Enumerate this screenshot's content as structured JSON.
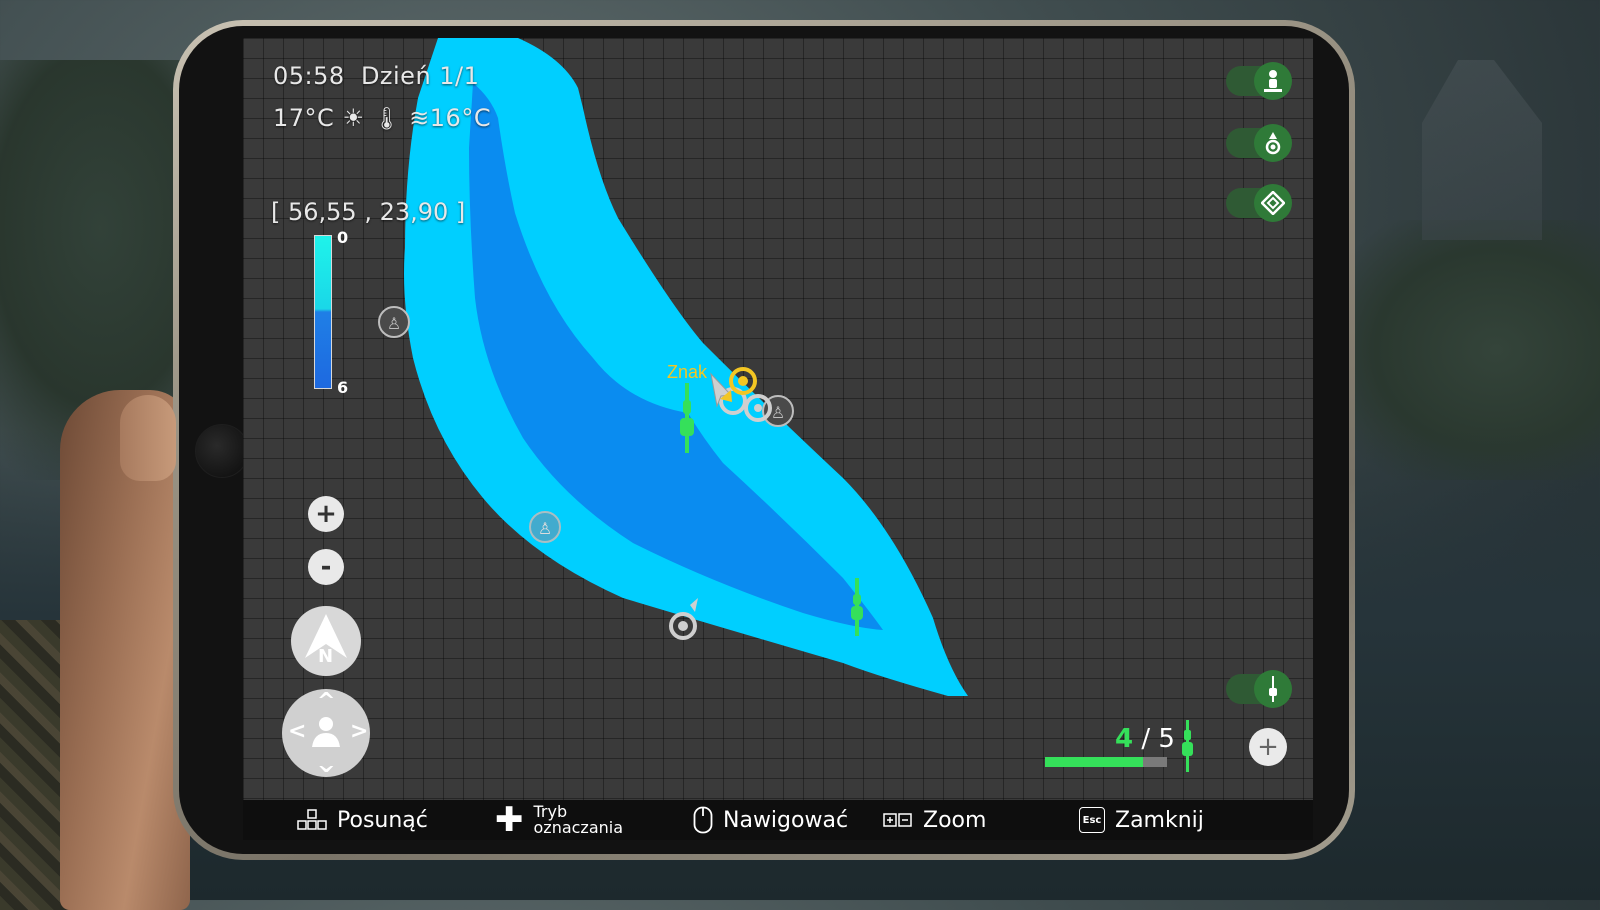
{
  "hud": {
    "time": "05:58",
    "day": "Dzień 1/1",
    "air_temp": "17°C",
    "water_temp": "16°C",
    "coordinates": "[ 56,55 , 23,90 ]"
  },
  "depth_scale": {
    "min": "0",
    "max": "6",
    "shallow_color": "#1ff3ea",
    "deep_color": "#1e69e0"
  },
  "map": {
    "marker_label": "Znak",
    "lake_shallow_color": "#00cfff",
    "lake_deep_color": "#0a8cf0",
    "grid_background": "#3a3a3a"
  },
  "controls": {
    "zoom_in": "+",
    "zoom_out": "-",
    "compass_letter": "N"
  },
  "side_buttons": [
    {
      "icon": "angler-icon"
    },
    {
      "icon": "location-pin-icon"
    },
    {
      "icon": "diamond-icon"
    },
    {
      "icon": "rod-icon"
    }
  ],
  "rods": {
    "current": "4",
    "separator": "/",
    "total": "5",
    "progress": 0.8,
    "add_label": "+"
  },
  "bottom_bar": {
    "move": "Posunąć",
    "mark_mode_line1": "Tryb",
    "mark_mode_line2": "oznaczania",
    "navigate": "Nawigować",
    "zoom": "Zoom",
    "close": "Zamknij",
    "esc_key": "Esc"
  },
  "accent_green": "#35e05a",
  "marker_yellow": "#f3c623"
}
